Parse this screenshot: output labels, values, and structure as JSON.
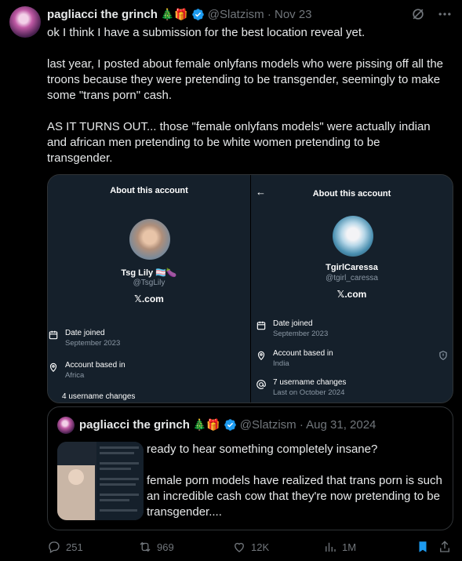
{
  "tweet": {
    "author_name": "pagliacci the grinch",
    "author_emoji": "🎄🎁",
    "handle_date": "@Slatzism · Nov 23",
    "text": "ok I think I have a submission for the best location reveal yet.\n\nlast year, I posted about female onlyfans models who were pissing off all the troons because they were pretending to be transgender, seemingly to make some \"trans porn\" cash.\n\nAS IT TURNS OUT... those \"female onlyfans models\" were actually indian and african men pretending to be white women pretending to be transgender."
  },
  "media": {
    "left": {
      "title": "About this account",
      "name": "Tsg Lily 🏳️‍⚧️🍆",
      "handle": "@TsgLily",
      "site": "𝕏.com",
      "date_label": "Date joined",
      "date_value": "September 2023",
      "location_label": "Account based in",
      "location_value": "Africa",
      "username_changes": "4 username changes"
    },
    "right": {
      "title": "About this account",
      "name": "TgirlCaressa",
      "handle": "@tgirl_caressa",
      "site": "𝕏.com",
      "date_label": "Date joined",
      "date_value": "September 2023",
      "location_label": "Account based in",
      "location_value": "India",
      "username_changes": "7 username changes",
      "last_change": "Last on October 2024"
    }
  },
  "quote": {
    "author_name": "pagliacci the grinch",
    "author_emoji": "🎄🎁",
    "handle_date": "@Slatzism · Aug 31, 2024",
    "text": "ready to hear something completely insane?\n\nfemale porn models have realized that trans porn is such an incredible cash cow that they're now pretending to be transgender...."
  },
  "actions": {
    "replies": "251",
    "reposts": "969",
    "likes": "12K",
    "views": "1M"
  },
  "colors": {
    "background": "#000000",
    "text": "#e7e9ea",
    "muted": "#71767b",
    "verified": "#1d9bf0",
    "bookmark": "#1d9bf0",
    "border": "#2f3336",
    "panel_bg": "#15202b"
  }
}
